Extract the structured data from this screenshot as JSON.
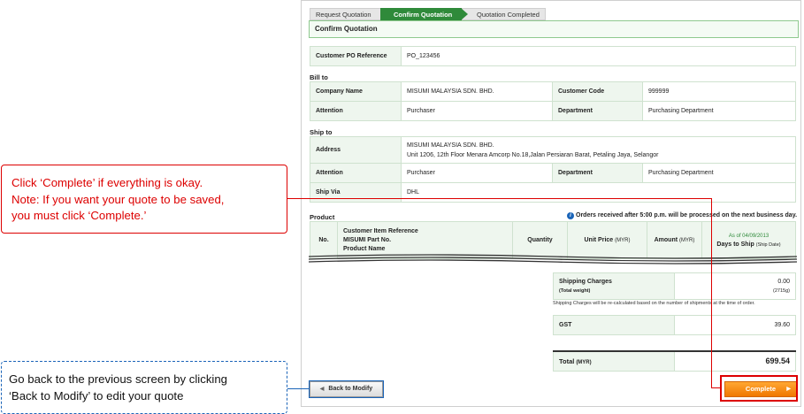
{
  "steps": [
    "Request Quotation",
    "Confirm Quotation",
    "Quotation Completed"
  ],
  "page_title": "Confirm Quotation",
  "po": {
    "label": "Customer PO Reference",
    "value": "PO_123456"
  },
  "bill_to": {
    "heading": "Bill to",
    "company_label": "Company Name",
    "company_value": "MISUMI MALAYSIA SDN. BHD.",
    "code_label": "Customer Code",
    "code_value": "999999",
    "attention_label": "Attention",
    "attention_value": "Purchaser",
    "dept_label": "Department",
    "dept_value": "Purchasing Department"
  },
  "ship_to": {
    "heading": "Ship to",
    "address_label": "Address",
    "address_line1": "MISUMI MALAYSIA SDN. BHD.",
    "address_line2": "Unit 1206, 12th Floor Menara Amcorp No.18,Jalan Persiaran Barat, Petaling Jaya, Selangor",
    "attention_label": "Attention",
    "attention_value": "Purchaser",
    "dept_label": "Department",
    "dept_value": "Purchasing Department",
    "via_label": "Ship Via",
    "via_value": "DHL"
  },
  "product": {
    "heading": "Product",
    "notice": "Orders received after 5:00 p.m. will be processed on the next business day.",
    "col_no": "No.",
    "col_ref1": "Customer Item Reference",
    "col_ref2": "MISUMI Part No.",
    "col_ref3": "Product Name",
    "col_qty": "Quantity",
    "col_unit": "Unit Price",
    "col_unit_cur": "(MYR)",
    "col_amount": "Amount",
    "col_amount_cur": "(MYR)",
    "col_asof": "As of 04/09/2013",
    "col_days": "Days to Ship",
    "col_days_sub": "(Ship Date)"
  },
  "totals": {
    "shipping_label": "Shipping Charges",
    "weight_label": "(Total weight)",
    "shipping_value": "0.00",
    "weight_value": "(2715g)",
    "recalc_note": "Shipping Charges will be re-calculated based on the number of shipments at the time of order.",
    "gst_label": "GST",
    "gst_value": "39.60",
    "total_label": "Total",
    "total_cur": "(MYR)",
    "total_value": "699.54"
  },
  "buttons": {
    "back": "Back to Modify",
    "complete": "Complete"
  },
  "callouts": {
    "complete_l1": "Click ‘Complete’ if everything is okay.",
    "complete_l2": "Note: If you want your quote to be saved,",
    "complete_l3": "you must click ‘Complete.’",
    "back_l1": "Go back to the previous screen by clicking",
    "back_l2": "‘Back to Modify’ to edit your quote"
  },
  "colors": {
    "accent_green": "#2f8a3a",
    "complete_orange": "#f07800",
    "callout_red": "#dd0000",
    "callout_blue": "#1a64b8"
  }
}
